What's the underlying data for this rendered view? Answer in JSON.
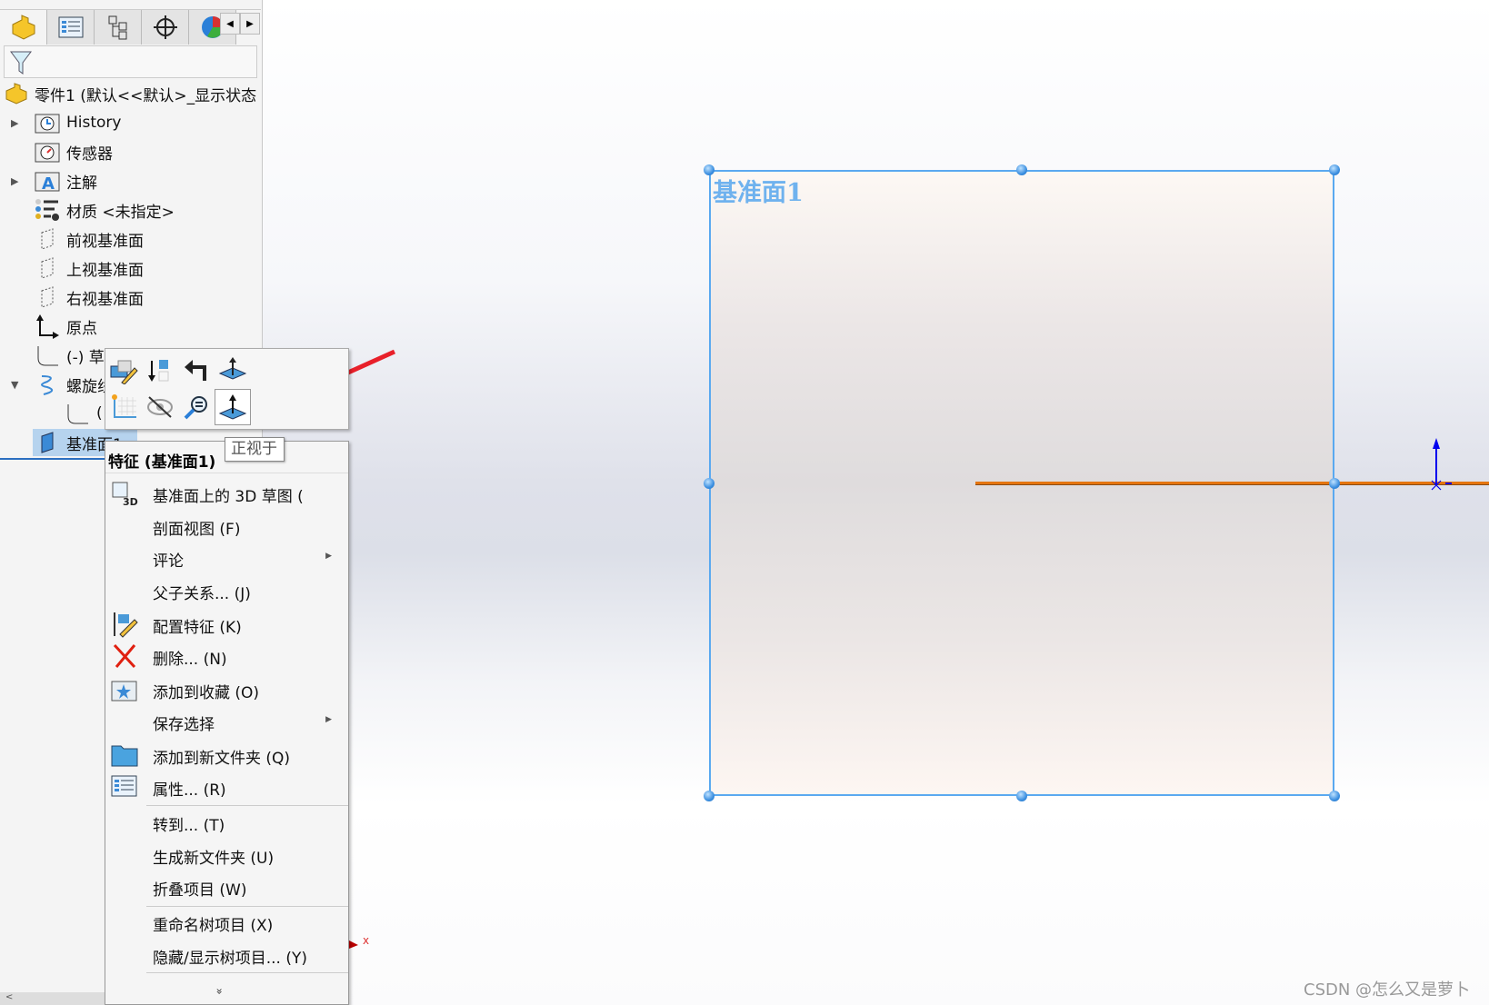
{
  "panel": {
    "tabs": [
      {
        "icon": "feature-manager-icon"
      },
      {
        "icon": "property-manager-icon"
      },
      {
        "icon": "configuration-manager-icon"
      },
      {
        "icon": "dimxpert-icon"
      },
      {
        "icon": "display-manager-icon"
      }
    ],
    "tree": {
      "root": "零件1  (默认<<默认>_显示状态",
      "items": [
        {
          "label": "History",
          "icon": "history-folder-icon",
          "expandable": true
        },
        {
          "label": "传感器",
          "icon": "sensor-folder-icon",
          "expandable": false
        },
        {
          "label": "注解",
          "icon": "annotation-folder-icon",
          "expandable": true
        },
        {
          "label": "材质 <未指定>",
          "icon": "material-icon",
          "expandable": false
        },
        {
          "label": "前视基准面",
          "icon": "plane-icon",
          "expandable": false
        },
        {
          "label": "上视基准面",
          "icon": "plane-icon",
          "expandable": false
        },
        {
          "label": "右视基准面",
          "icon": "plane-icon",
          "expandable": false
        },
        {
          "label": "原点",
          "icon": "origin-icon",
          "expandable": false
        },
        {
          "label": "(-) 草",
          "icon": "sketch-icon",
          "expandable": false
        },
        {
          "label": "螺旋线",
          "icon": "helix-icon",
          "expandable": true,
          "expanded": true
        },
        {
          "label": "(",
          "icon": "sketch-icon",
          "expandable": false
        },
        {
          "label": "基准面1",
          "icon": "plane-icon",
          "selected": true
        }
      ]
    }
  },
  "context_toolbar": {
    "tooltip": "正视于"
  },
  "context_menu": {
    "header": "特征 (基准面1)",
    "items": [
      {
        "label": "基准面上的 3D 草图 (",
        "icon": "3d-sketch-icon"
      },
      {
        "label": "剖面视图 (F)"
      },
      {
        "label": "评论",
        "submenu": true
      },
      {
        "label": "父子关系... (J)"
      },
      {
        "label": "配置特征 (K)",
        "icon": "configure-feature-icon"
      },
      {
        "label": "删除... (N)",
        "icon": "delete-icon"
      },
      {
        "label": "添加到收藏 (O)",
        "icon": "favorite-icon"
      },
      {
        "label": "保存选择",
        "submenu": true
      },
      {
        "label": "添加到新文件夹 (Q)",
        "icon": "folder-icon"
      },
      {
        "label": "属性... (R)",
        "icon": "properties-icon"
      },
      {
        "label": "转到... (T)"
      },
      {
        "label": "生成新文件夹 (U)"
      },
      {
        "label": "折叠项目 (W)"
      },
      {
        "label": "重命名树项目 (X)"
      },
      {
        "label": "隐藏/显示树项目... (Y)"
      }
    ],
    "more": "»"
  },
  "viewport": {
    "plane_label": "基准面1",
    "axis_label": "x",
    "plane_color": "#5aa9f0",
    "sketch_color": "#e5750f",
    "arrow_color": "#e8202a"
  },
  "watermark": "CSDN @怎么又是萝卜"
}
